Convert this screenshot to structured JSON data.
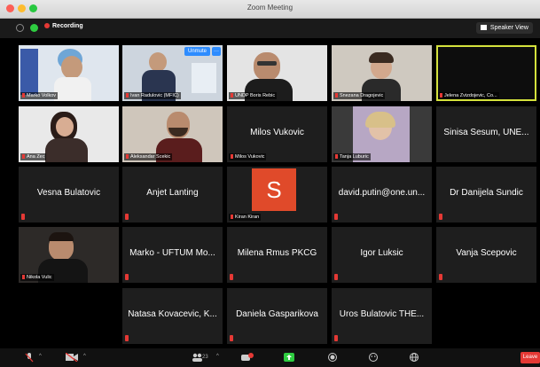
{
  "window": {
    "title": "Zoom Meeting"
  },
  "topbar": {
    "recording": "Recording",
    "view_button": "Speaker View"
  },
  "unmute_label": "Unmute",
  "tiles": [
    {
      "id": "marko",
      "label": "Marko Volkov"
    },
    {
      "id": "ivan",
      "label": "Ivan Radulovic (MFIC)"
    },
    {
      "id": "boris",
      "label": "UNDP Boris Rebic"
    },
    {
      "id": "snezana",
      "label": "Snezana Dragojevic"
    },
    {
      "id": "jelena",
      "label": "Jelena Zvizdojevic, Co..."
    },
    {
      "id": "ana",
      "label": "Ana Zec"
    },
    {
      "id": "aleksandar",
      "label": "Aleksandar Scekic"
    },
    {
      "id": "milos",
      "name": "Milos Vukovic",
      "label": "Milos Vukovic"
    },
    {
      "id": "tanja",
      "label": "Tanja Luburic"
    },
    {
      "id": "sinisa",
      "name": "Sinisa Sesum, UNE..."
    },
    {
      "id": "vesna",
      "name": "Vesna Bulatovic"
    },
    {
      "id": "anjet",
      "name": "Anjet Lanting"
    },
    {
      "id": "kiran",
      "avatar": "S",
      "label": "Kiran Kiran"
    },
    {
      "id": "david",
      "name": "david.putin@one.un..."
    },
    {
      "id": "danijela",
      "name": "Dr Danijela Sundic"
    },
    {
      "id": "nikola",
      "label": "Nikola Vulic"
    },
    {
      "id": "uftum",
      "name": "Marko - UFTUM Mo..."
    },
    {
      "id": "milena",
      "name": "Milena Rmus PKCG"
    },
    {
      "id": "igor",
      "name": "Igor Luksic"
    },
    {
      "id": "vanja",
      "name": "Vanja Scepovic"
    },
    {
      "id": "natasa",
      "name": "Natasa Kovacevic, K..."
    },
    {
      "id": "daniela",
      "name": "Daniela Gasparikova"
    },
    {
      "id": "uros",
      "name": "Uros Bulatovic THE..."
    }
  ],
  "bottombar": {
    "participants_count": "23",
    "leave": "Leave"
  },
  "colors": {
    "highlight": "#d4e13c",
    "avatar": "#e04a2a",
    "muted": "#e53935",
    "unmute": "#2d8cff"
  }
}
